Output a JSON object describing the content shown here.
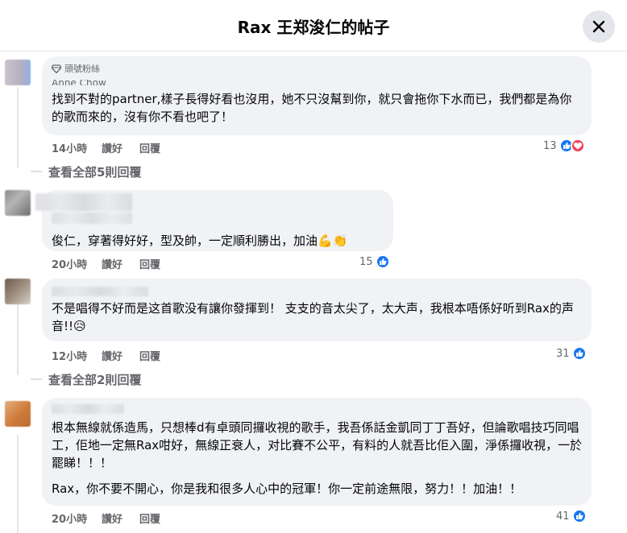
{
  "header": {
    "title": "Rax 王郑浚仁的帖子"
  },
  "comments": [
    {
      "badge": "頭號粉絲",
      "author": "Anne Chow",
      "text": "找到不對的partner,樣子長得好看也沒用，她不只沒幫到你，就只會拖你下水而已，我們都是為你的歌而來的，沒有你不看也吧了！",
      "time": "14小時",
      "like": "讚好",
      "reply": "回覆",
      "reactions": "13",
      "view_replies": "查看全部5則回覆"
    },
    {
      "text": "俊仁，穿著得好好，型及帥，一定順利勝出，加油💪👏",
      "time": "20小時",
      "like": "讚好",
      "reply": "回覆",
      "reactions": "15"
    },
    {
      "text": "不是唱得不好而是这首歌没有讓你發揮到！ 支支的音太尖了，太大声，我根本唔係好听到Rax的声音!!😥",
      "time": "12小時",
      "like": "讚好",
      "reply": "回覆",
      "reactions": "31",
      "view_replies": "查看全部2則回覆"
    },
    {
      "text": "根本無線就係造馬，只想棒d有卓頭同攞收視的歌手，我吾係話金凱同丁丁吾好，但論歌唱技巧同唱工，佢地一定無Rax咁好，無線正衰人，对比賽不公平，有料的人就吾比佢入圍，淨係攞收視，一於罷睇！！！",
      "text2": "Rax，你不要不開心，你是我和很多人心中的冠軍！你一定前途無限，努力！！加油！！",
      "time": "20小時",
      "like": "讚好",
      "reply": "回覆",
      "reactions": "41"
    }
  ],
  "colors": {
    "like_blue": "#1877f2",
    "love_red": "#f33e58",
    "bubble": "#f0f2f5",
    "meta": "#65676b"
  },
  "icons": {
    "close": "close-icon",
    "like": "like-reaction-icon",
    "love": "love-reaction-icon",
    "badge": "diamond-icon"
  }
}
